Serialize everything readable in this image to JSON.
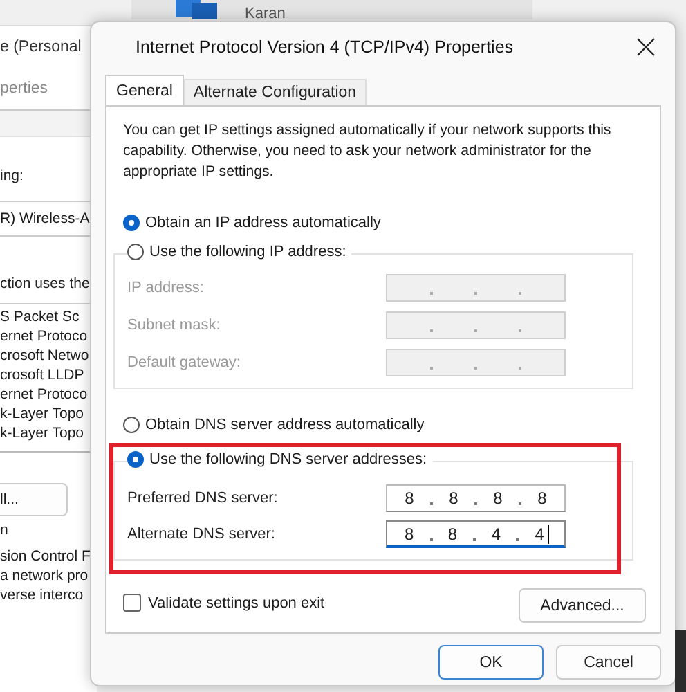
{
  "desktop_window": {
    "name": "Karan"
  },
  "background_window": {
    "title": "e (Personal",
    "tab": "perties",
    "connect_label": "ing:",
    "adapter": "R) Wireless-A",
    "items_label": "ction uses the",
    "items": [
      "S Packet Sc",
      "ernet Protoco",
      "crosoft Netwo",
      "crosoft LLDP",
      "ernet Protoco",
      "k-Layer Topo",
      "k-Layer Topo"
    ],
    "button": "ll...",
    "description_label": "n",
    "description_lines": [
      "sion Control F",
      "a network pro",
      "verse interco"
    ]
  },
  "dialog": {
    "title": "Internet Protocol Version 4 (TCP/IPv4) Properties",
    "tabs": [
      {
        "label": "General",
        "selected": true
      },
      {
        "label": "Alternate Configuration",
        "selected": false
      }
    ],
    "description": "You can get IP settings assigned automatically if your network supports this capability. Otherwise, you need to ask your network administrator for the appropriate IP settings.",
    "ip_options": [
      {
        "label": "Obtain an IP address automatically",
        "selected": true
      },
      {
        "label": "Use the following IP address:",
        "selected": false
      }
    ],
    "ip_fields": [
      {
        "label": "IP address:",
        "disabled": true
      },
      {
        "label": "Subnet mask:",
        "disabled": true
      },
      {
        "label": "Default gateway:",
        "disabled": true
      }
    ],
    "dns_options": [
      {
        "label": "Obtain DNS server address automatically",
        "selected": false
      },
      {
        "label": "Use the following DNS server addresses:",
        "selected": true
      }
    ],
    "dns_fields": [
      {
        "label": "Preferred DNS server:",
        "disabled": false,
        "focused": false,
        "octets": [
          "8",
          "8",
          "8",
          "8"
        ]
      },
      {
        "label": "Alternate DNS server:",
        "disabled": false,
        "focused": true,
        "octets": [
          "8",
          "8",
          "4",
          "4"
        ]
      }
    ],
    "validate": {
      "label": "Validate settings upon exit",
      "checked": false
    },
    "advanced_button": "Advanced...",
    "buttons": [
      {
        "label": "OK",
        "default": true
      },
      {
        "label": "Cancel",
        "default": false
      }
    ]
  }
}
